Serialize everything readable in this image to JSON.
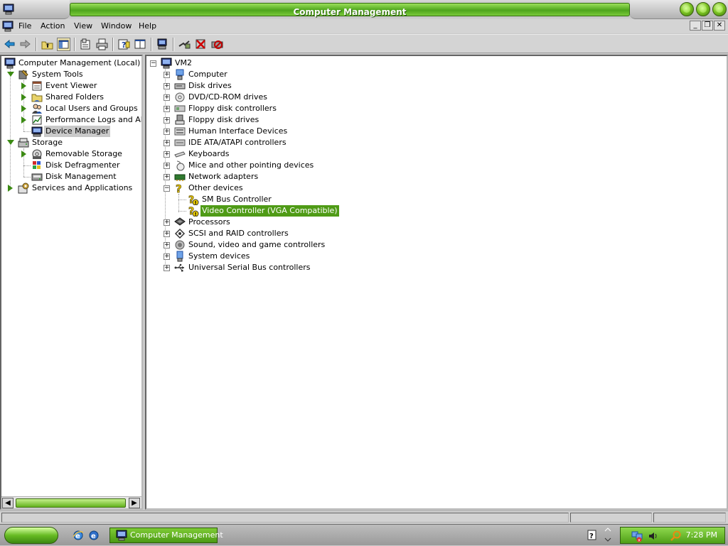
{
  "window": {
    "title": "Computer Management"
  },
  "menu": [
    "File",
    "Action",
    "View",
    "Window",
    "Help"
  ],
  "left_tree": [
    {
      "label": "Computer Management (Local)",
      "icon": "computer-management-icon"
    },
    {
      "label": "System Tools",
      "icon": "system-tools-icon"
    },
    {
      "label": "Event Viewer",
      "icon": "event-viewer-icon"
    },
    {
      "label": "Shared Folders",
      "icon": "shared-folders-icon"
    },
    {
      "label": "Local Users and Groups",
      "icon": "users-icon"
    },
    {
      "label": "Performance Logs and Alerts",
      "icon": "performance-icon"
    },
    {
      "label": "Device Manager",
      "icon": "device-manager-icon"
    },
    {
      "label": "Storage",
      "icon": "storage-icon"
    },
    {
      "label": "Removable Storage",
      "icon": "removable-storage-icon"
    },
    {
      "label": "Disk Defragmenter",
      "icon": "defrag-icon"
    },
    {
      "label": "Disk Management",
      "icon": "disk-management-icon"
    },
    {
      "label": "Services and Applications",
      "icon": "services-icon"
    }
  ],
  "device_tree": {
    "root": "VM2",
    "items": [
      {
        "label": "Computer",
        "icon": "computer-icon"
      },
      {
        "label": "Disk drives",
        "icon": "disk-drive-icon"
      },
      {
        "label": "DVD/CD-ROM drives",
        "icon": "cdrom-icon"
      },
      {
        "label": "Floppy disk controllers",
        "icon": "floppy-controller-icon"
      },
      {
        "label": "Floppy disk drives",
        "icon": "floppy-drive-icon"
      },
      {
        "label": "Human Interface Devices",
        "icon": "hid-icon"
      },
      {
        "label": "IDE ATA/ATAPI controllers",
        "icon": "ide-icon"
      },
      {
        "label": "Keyboards",
        "icon": "keyboard-icon"
      },
      {
        "label": "Mice and other pointing devices",
        "icon": "mouse-icon"
      },
      {
        "label": "Network adapters",
        "icon": "network-adapter-icon"
      },
      {
        "label": "Other devices",
        "icon": "unknown-device-icon"
      },
      {
        "label": "SM Bus Controller",
        "icon": "warning-device-icon"
      },
      {
        "label": "Video Controller (VGA Compatible)",
        "icon": "warning-device-icon"
      },
      {
        "label": "Processors",
        "icon": "processor-icon"
      },
      {
        "label": "SCSI and RAID controllers",
        "icon": "scsi-icon"
      },
      {
        "label": "Sound, video and game controllers",
        "icon": "sound-icon"
      },
      {
        "label": "System devices",
        "icon": "system-devices-icon"
      },
      {
        "label": "Universal Serial Bus controllers",
        "icon": "usb-icon"
      }
    ]
  },
  "taskbar": {
    "task_label": "Computer Management",
    "clock": "7:28 PM"
  },
  "colors": {
    "accent_green": "#4f9b16",
    "selection_gray": "#c9c9c9"
  }
}
